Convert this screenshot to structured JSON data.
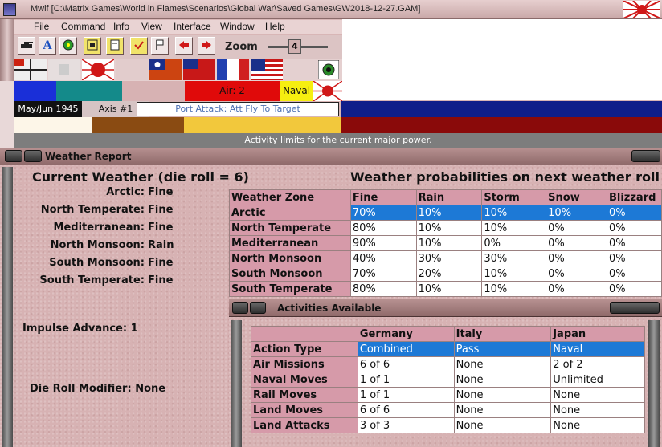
{
  "window_title": "Mwif [C:\\Matrix Games\\World in Flames\\Scenarios\\Global War\\Saved Games\\GW2018-12-27.GAM]",
  "menu": [
    "File",
    "Command",
    "Info",
    "View",
    "Interface",
    "Window",
    "Help"
  ],
  "toolbar": {
    "buttons": [
      "tank-icon",
      "A",
      "circle-icon",
      "grid-icon",
      "page-icon",
      "check-icon",
      "flag-icon",
      "arrow-left-icon",
      "arrow-right-icon"
    ],
    "zoom_label": "Zoom",
    "zoom_value": "4"
  },
  "info_row": {
    "air": "Air: 2",
    "naval": "Naval"
  },
  "date": "May/Jun 1945",
  "axis_impulse": "Axis #1",
  "port_attack": "Port Attack: Att Fly To Target",
  "status_text": "Activity limits for the current major power.",
  "weather_window": {
    "title": "Weather Report",
    "current_weather_title": "Current Weather (die roll = 6)",
    "probabilities_title": "Weather probabilities on next weather roll",
    "current": [
      {
        "zone": "Arctic:",
        "value": "Fine"
      },
      {
        "zone": "North Temperate:",
        "value": "Fine"
      },
      {
        "zone": "Mediterranean:",
        "value": "Fine"
      },
      {
        "zone": "North Monsoon:",
        "value": "Rain"
      },
      {
        "zone": "South Monsoon:",
        "value": "Fine"
      },
      {
        "zone": "South Temperate:",
        "value": "Fine"
      }
    ],
    "impulse_advance_label": "Impulse Advance:",
    "impulse_advance_value": "1",
    "die_roll_modifier_label": "Die Roll Modifier:",
    "die_roll_modifier_value": "None",
    "prob_headers": [
      "Weather Zone",
      "Fine",
      "Rain",
      "Storm",
      "Snow",
      "Blizzard"
    ],
    "prob_rows": [
      [
        "Arctic",
        "70%",
        "10%",
        "10%",
        "10%",
        "0%"
      ],
      [
        "North Temperate",
        "80%",
        "10%",
        "10%",
        "0%",
        "0%"
      ],
      [
        "Mediterranean",
        "90%",
        "10%",
        "0%",
        "0%",
        "0%"
      ],
      [
        "North Monsoon",
        "40%",
        "30%",
        "30%",
        "0%",
        "0%"
      ],
      [
        "South Monsoon",
        "70%",
        "20%",
        "10%",
        "0%",
        "0%"
      ],
      [
        "South Temperate",
        "80%",
        "10%",
        "10%",
        "0%",
        "0%"
      ]
    ]
  },
  "activities_window": {
    "title": "Activities Available",
    "headers": [
      "",
      "Germany",
      "Italy",
      "Japan"
    ],
    "rows": [
      [
        "Action Type",
        "Combined",
        "Pass",
        "Naval"
      ],
      [
        "Air Missions",
        "6 of 6",
        "None",
        "2 of 2"
      ],
      [
        "Naval Moves",
        "1 of 1",
        "None",
        "Unlimited"
      ],
      [
        "Rail Moves",
        "1 of 1",
        "None",
        "None"
      ],
      [
        "Land Moves",
        "6 of 6",
        "None",
        "None"
      ],
      [
        "Land Attacks",
        "3 of 3",
        "None",
        "None"
      ]
    ]
  },
  "colors": {
    "selection": "#1d79d6",
    "header_pink": "#d69aa9",
    "status_gray": "#7d7d7d",
    "navy": "#0f1e8a"
  }
}
